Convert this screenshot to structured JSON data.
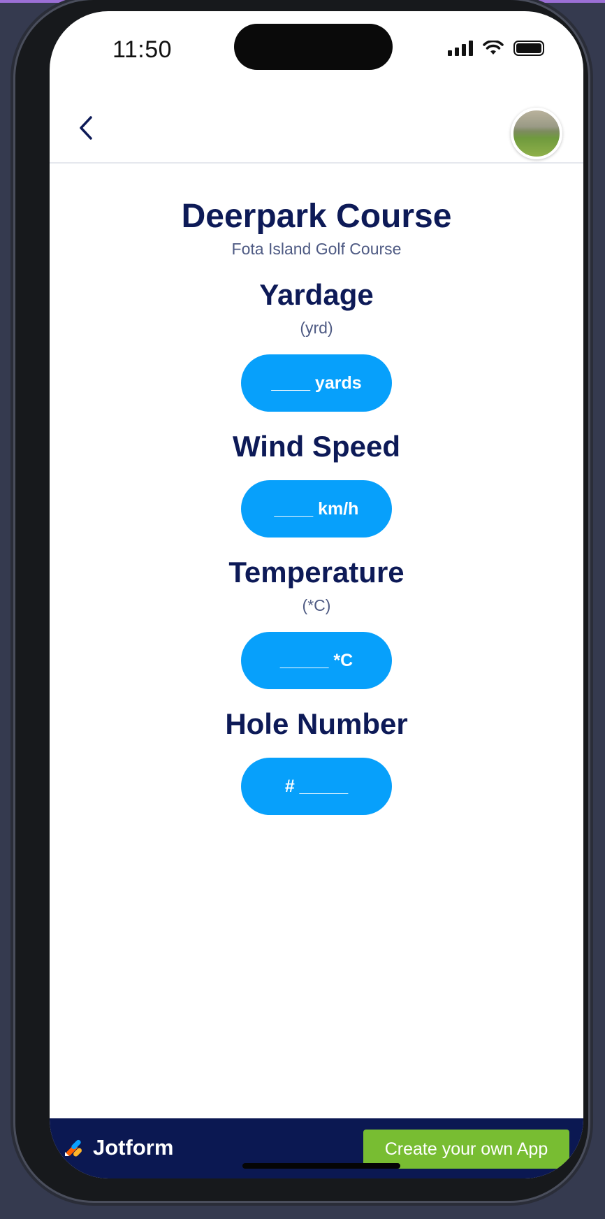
{
  "status_bar": {
    "time": "11:50"
  },
  "header": {
    "back_icon": "chevron-left-icon",
    "avatar_alt": "Golf course photo"
  },
  "course": {
    "title": "Deerpark Course",
    "subtitle": "Fota Island Golf Course"
  },
  "fields": [
    {
      "title": "Yardage",
      "unit": "(yrd)",
      "button": "____ yards"
    },
    {
      "title": "Wind Speed",
      "unit": "",
      "button": "____ km/h"
    },
    {
      "title": "Temperature",
      "unit": "(*C)",
      "button": "_____ *C"
    },
    {
      "title": "Hole Number",
      "unit": "",
      "button": "# _____"
    }
  ],
  "footer": {
    "brand": "Jotform",
    "cta": "Create your own App"
  },
  "colors": {
    "primary": "#07a0fb",
    "heading": "#0d1a57",
    "footer": "#0b1852",
    "cta": "#78bd32"
  }
}
